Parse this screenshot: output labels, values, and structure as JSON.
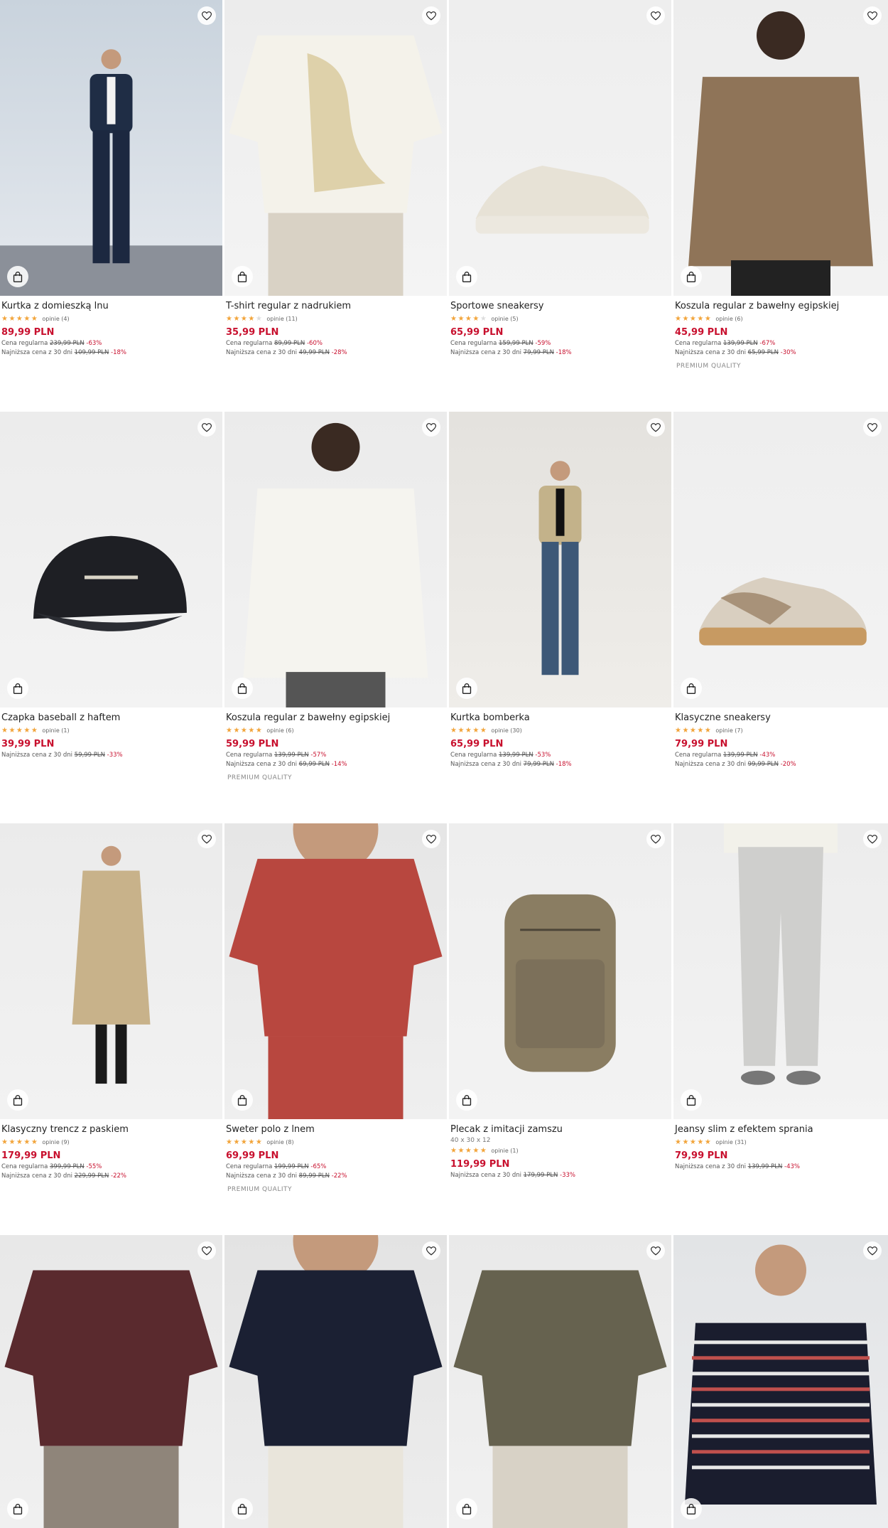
{
  "colors": {
    "price": "#c8102e",
    "star": "#f2a43a",
    "text": "#222222"
  },
  "icons": {
    "favorite": "heart-outline-icon",
    "cart": "shopping-bag-icon",
    "rating": "star-icon"
  },
  "products": [
    {
      "name": "Kurtka z domieszką lnu",
      "dims": "",
      "stars": 5,
      "reviews": "opinie (4)",
      "price": "89,99 PLN",
      "regular": {
        "label": "Cena regularna",
        "old": "239,99 PLN",
        "pct": "-63%"
      },
      "lowest": {
        "label": "Najniższa cena z 30 dni",
        "old": "109,99 PLN",
        "pct": "-18%"
      },
      "badge": ""
    },
    {
      "name": "T-shirt regular z nadrukiem",
      "dims": "",
      "stars": 4,
      "reviews": "opinie (11)",
      "price": "35,99 PLN",
      "regular": {
        "label": "Cena regularna",
        "old": "89,99 PLN",
        "pct": "-60%"
      },
      "lowest": {
        "label": "Najniższa cena z 30 dni",
        "old": "49,99 PLN",
        "pct": "-28%"
      },
      "badge": ""
    },
    {
      "name": "Sportowe sneakersy",
      "dims": "",
      "stars": 4,
      "reviews": "opinie (5)",
      "price": "65,99 PLN",
      "regular": {
        "label": "Cena regularna",
        "old": "159,99 PLN",
        "pct": "-59%"
      },
      "lowest": {
        "label": "Najniższa cena z 30 dni",
        "old": "79,99 PLN",
        "pct": "-18%"
      },
      "badge": ""
    },
    {
      "name": "Koszula regular z bawełny egipskiej",
      "dims": "",
      "stars": 5,
      "reviews": "opinie (6)",
      "price": "45,99 PLN",
      "regular": {
        "label": "Cena regularna",
        "old": "139,99 PLN",
        "pct": "-67%"
      },
      "lowest": {
        "label": "Najniższa cena z 30 dni",
        "old": "65,99 PLN",
        "pct": "-30%"
      },
      "badge": "PREMIUM QUALITY"
    },
    {
      "name": "Czapka baseball z haftem",
      "dims": "",
      "stars": 5,
      "reviews": "opinie (1)",
      "price": "39,99 PLN",
      "regular": null,
      "lowest": {
        "label": "Najniższa cena z 30 dni",
        "old": "59,99 PLN",
        "pct": "-33%"
      },
      "badge": ""
    },
    {
      "name": "Koszula regular z bawełny egipskiej",
      "dims": "",
      "stars": 5,
      "reviews": "opinie (6)",
      "price": "59,99 PLN",
      "regular": {
        "label": "Cena regularna",
        "old": "139,99 PLN",
        "pct": "-57%"
      },
      "lowest": {
        "label": "Najniższa cena z 30 dni",
        "old": "69,99 PLN",
        "pct": "-14%"
      },
      "badge": "PREMIUM QUALITY"
    },
    {
      "name": "Kurtka bomberka",
      "dims": "",
      "stars": 5,
      "reviews": "opinie (30)",
      "price": "65,99 PLN",
      "regular": {
        "label": "Cena regularna",
        "old": "139,99 PLN",
        "pct": "-53%"
      },
      "lowest": {
        "label": "Najniższa cena z 30 dni",
        "old": "79,99 PLN",
        "pct": "-18%"
      },
      "badge": ""
    },
    {
      "name": "Klasyczne sneakersy",
      "dims": "",
      "stars": 5,
      "reviews": "opinie (7)",
      "price": "79,99 PLN",
      "regular": {
        "label": "Cena regularna",
        "old": "139,99 PLN",
        "pct": "-43%"
      },
      "lowest": {
        "label": "Najniższa cena z 30 dni",
        "old": "99,99 PLN",
        "pct": "-20%"
      },
      "badge": ""
    },
    {
      "name": "Klasyczny trencz z paskiem",
      "dims": "",
      "stars": 5,
      "reviews": "opinie (9)",
      "price": "179,99 PLN",
      "regular": {
        "label": "Cena regularna",
        "old": "399,99 PLN",
        "pct": "-55%"
      },
      "lowest": {
        "label": "Najniższa cena z 30 dni",
        "old": "229,99 PLN",
        "pct": "-22%"
      },
      "badge": ""
    },
    {
      "name": "Sweter polo z lnem",
      "dims": "",
      "stars": 5,
      "reviews": "opinie (8)",
      "price": "69,99 PLN",
      "regular": {
        "label": "Cena regularna",
        "old": "199,99 PLN",
        "pct": "-65%"
      },
      "lowest": {
        "label": "Najniższa cena z 30 dni",
        "old": "89,99 PLN",
        "pct": "-22%"
      },
      "badge": "PREMIUM QUALITY"
    },
    {
      "name": "Plecak z imitacji zamszu",
      "dims": "40 x 30 x 12",
      "stars": 5,
      "reviews": "opinie (1)",
      "price": "119,99 PLN",
      "regular": null,
      "lowest": {
        "label": "Najniższa cena z 30 dni",
        "old": "179,99 PLN",
        "pct": "-33%"
      },
      "badge": ""
    },
    {
      "name": "Jeansy slim z efektem sprania",
      "dims": "",
      "stars": 5,
      "reviews": "opinie (31)",
      "price": "79,99 PLN",
      "regular": null,
      "lowest": {
        "label": "Najniższa cena z 30 dni",
        "old": "139,99 PLN",
        "pct": "-43%"
      },
      "badge": ""
    },
    {
      "name": "",
      "dims": "",
      "stars": 0,
      "reviews": "",
      "price": "",
      "regular": null,
      "lowest": null,
      "badge": ""
    },
    {
      "name": "",
      "dims": "",
      "stars": 0,
      "reviews": "",
      "price": "",
      "regular": null,
      "lowest": null,
      "badge": ""
    },
    {
      "name": "",
      "dims": "",
      "stars": 0,
      "reviews": "",
      "price": "",
      "regular": null,
      "lowest": null,
      "badge": ""
    },
    {
      "name": "",
      "dims": "",
      "stars": 0,
      "reviews": "",
      "price": "",
      "regular": null,
      "lowest": null,
      "badge": ""
    }
  ]
}
